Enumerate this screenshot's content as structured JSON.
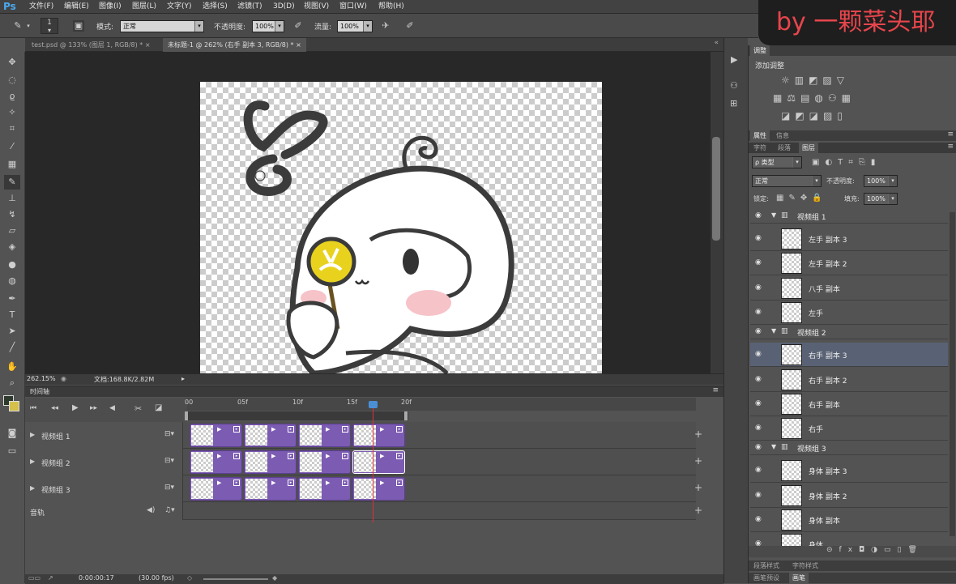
{
  "app": {
    "logo": "Ps"
  },
  "menu": [
    "文件(F)",
    "编辑(E)",
    "图像(I)",
    "图层(L)",
    "文字(Y)",
    "选择(S)",
    "滤镜(T)",
    "3D(D)",
    "视图(V)",
    "窗口(W)",
    "帮助(H)"
  ],
  "watermark": "by 一颗菜头耶",
  "options": {
    "brush_size": "1",
    "mode_label": "模式:",
    "mode_value": "正常",
    "opacity_label": "不透明度:",
    "opacity_value": "100%",
    "flow_label": "流量:",
    "flow_value": "100%"
  },
  "doc_tabs": [
    {
      "label": "test.psd @ 133% (图层 1, RGB/8) *",
      "close": "×"
    },
    {
      "label": "未标题-1 @ 262% (右手 副本 3, RGB/8) *",
      "close": "×"
    }
  ],
  "status": {
    "zoom": "262.15%",
    "doc": "文档:168.8K/2.82M"
  },
  "timeline": {
    "title": "时间轴",
    "ruler": [
      "00",
      "05f",
      "10f",
      "15f",
      "20f"
    ],
    "tracks": [
      {
        "name": "视频组 1"
      },
      {
        "name": "视频组 2"
      },
      {
        "name": "视频组 3"
      }
    ],
    "audio": "音轨",
    "timecode": "0:00:00:17",
    "fps": "(30.00 fps)"
  },
  "panels": {
    "adjust_tabs": [
      "调整"
    ],
    "adjust_title": "添加调整",
    "props_tabs": [
      "属性",
      "信息"
    ],
    "layer_tabs": [
      "字符",
      "段落",
      "图层"
    ],
    "filter_kind": "ρ 类型",
    "blend_mode": "正常",
    "opacity_label": "不透明度:",
    "opacity_value": "100%",
    "lock_label": "锁定:",
    "fill_label": "填充:",
    "fill_value": "100%",
    "bottom_tabs": [
      "段落样式",
      "字符样式"
    ],
    "bottom_tabs2": [
      "画笔预设",
      "画笔"
    ]
  },
  "layers": [
    {
      "type": "group",
      "name": "视频组 1"
    },
    {
      "type": "layer",
      "name": "左手 副本 3"
    },
    {
      "type": "layer",
      "name": "左手 副本 2"
    },
    {
      "type": "layer",
      "name": "八手 副本"
    },
    {
      "type": "layer",
      "name": "左手"
    },
    {
      "type": "group",
      "name": "视频组 2"
    },
    {
      "type": "layer",
      "name": "右手 副本 3",
      "selected": true
    },
    {
      "type": "layer",
      "name": "右手 副本 2"
    },
    {
      "type": "layer",
      "name": "右手 副本"
    },
    {
      "type": "layer",
      "name": "右手"
    },
    {
      "type": "group",
      "name": "视频组 3"
    },
    {
      "type": "layer",
      "name": "身体 副本 3"
    },
    {
      "type": "layer",
      "name": "身体 副本 2"
    },
    {
      "type": "layer",
      "name": "身体 副本"
    },
    {
      "type": "layer",
      "name": "身体"
    }
  ],
  "icons": {
    "eye": "eye-icon",
    "folder": "folder-icon"
  }
}
